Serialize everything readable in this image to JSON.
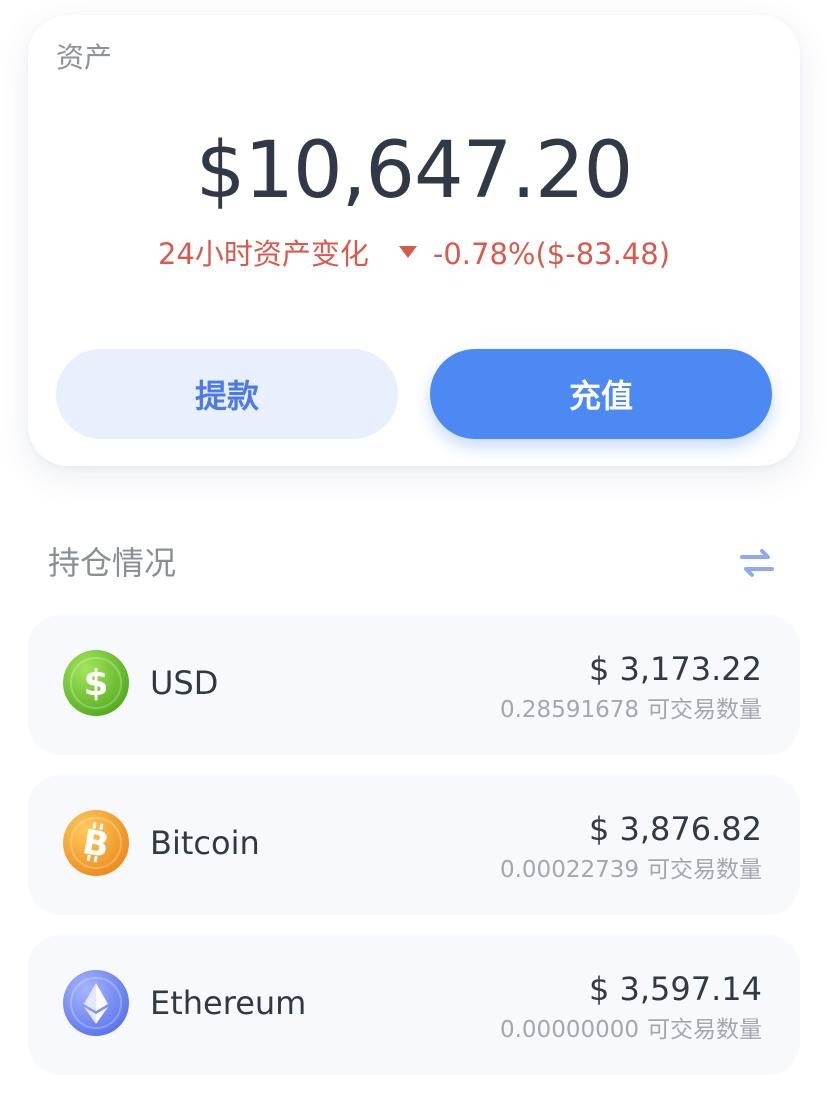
{
  "asset_card": {
    "label": "资产",
    "total": "$10,647.20",
    "change_label": "24小时资产变化",
    "change_value": "-0.78%($-83.48)",
    "withdraw_label": "提款",
    "deposit_label": "充值"
  },
  "holdings": {
    "title": "持仓情况",
    "items": [
      {
        "name": "USD",
        "value": "$ 3,173.22",
        "amount": "0.28591678",
        "unit": "可交易数量",
        "icon": "dollar-coin-icon",
        "color": "#6fc02b"
      },
      {
        "name": "Bitcoin",
        "value": "$ 3,876.82",
        "amount": "0.00022739",
        "unit": "可交易数量",
        "icon": "bitcoin-icon",
        "color": "#f2a32c"
      },
      {
        "name": "Ethereum",
        "value": "$ 3,597.14",
        "amount": "0.00000000",
        "unit": "可交易数量",
        "icon": "ethereum-icon",
        "color": "#6e86f2"
      }
    ]
  },
  "colors": {
    "accent": "#4d89f2",
    "negative": "#d85a4f",
    "text_primary": "#323946",
    "text_secondary": "#8e929b"
  }
}
